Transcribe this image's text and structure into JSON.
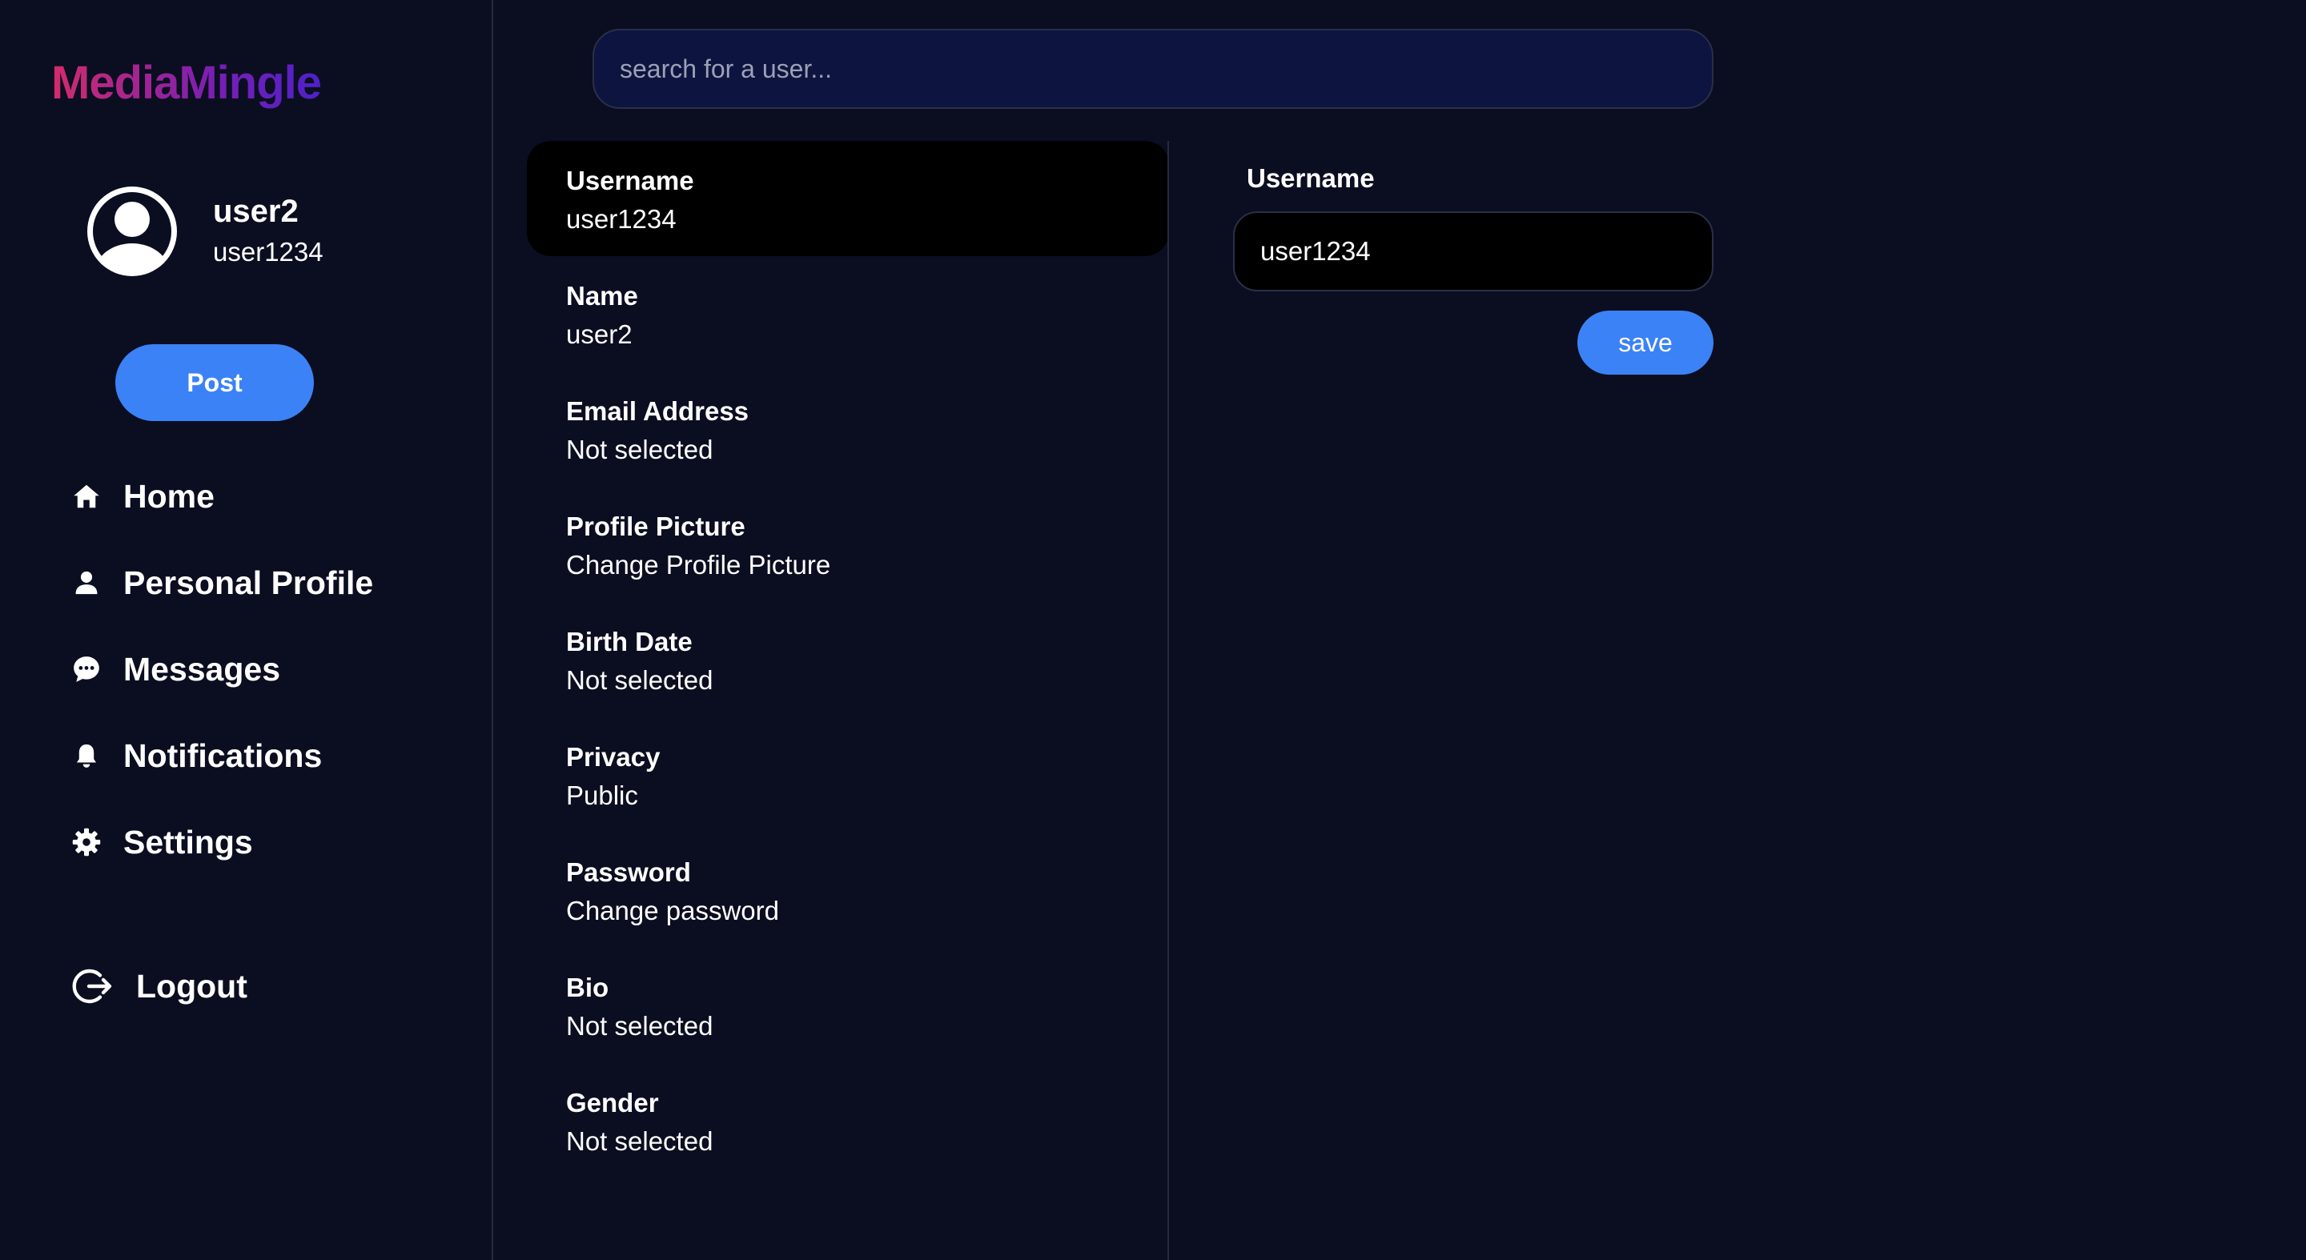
{
  "app": {
    "logo_text": "MediaMingle"
  },
  "profile": {
    "name": "user2",
    "handle": "user1234",
    "avatar_icon": "user-circle-icon"
  },
  "sidebar": {
    "post_label": "Post",
    "items": [
      {
        "label": "Home",
        "icon": "home-icon"
      },
      {
        "label": "Personal Profile",
        "icon": "person-icon"
      },
      {
        "label": "Messages",
        "icon": "chat-bubble-icon"
      },
      {
        "label": "Notifications",
        "icon": "bell-icon"
      },
      {
        "label": "Settings",
        "icon": "gear-icon"
      }
    ],
    "logout_label": "Logout",
    "logout_icon": "logout-icon"
  },
  "search": {
    "placeholder": "search for a user..."
  },
  "settings": {
    "items": [
      {
        "label": "Username",
        "value": "user1234",
        "selected": true
      },
      {
        "label": "Name",
        "value": "user2"
      },
      {
        "label": "Email Address",
        "value": "Not selected"
      },
      {
        "label": "Profile Picture",
        "value": "Change Profile Picture"
      },
      {
        "label": "Birth Date",
        "value": "Not selected"
      },
      {
        "label": "Privacy",
        "value": "Public"
      },
      {
        "label": "Password",
        "value": "Change password"
      },
      {
        "label": "Bio",
        "value": "Not selected"
      },
      {
        "label": "Gender",
        "value": "Not selected"
      }
    ]
  },
  "editor": {
    "label": "Username",
    "value": "user1234",
    "save_label": "save"
  },
  "colors": {
    "background": "#0b0e20",
    "accent": "#3b82f6",
    "search_bg": "#0e1440",
    "logo_gradient_start": "#d12c6b",
    "logo_gradient_end": "#4d21c9"
  }
}
